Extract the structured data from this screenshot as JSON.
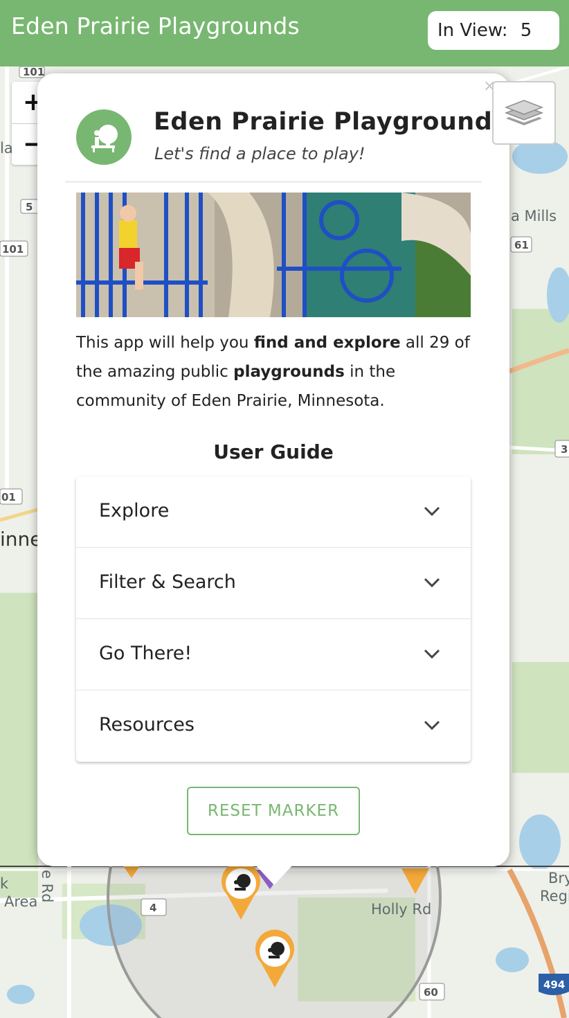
{
  "header": {
    "title": "Eden Prairie Playgrounds",
    "in_view_label": "In View:",
    "in_view_count": "5"
  },
  "map_controls": {
    "zoom_in": "+",
    "zoom_out": "−"
  },
  "popup": {
    "title": "Eden Prairie Playgrounds",
    "subtitle": "Let's find a place to play!",
    "description": {
      "p1": "This app will help you ",
      "b1": "find and explore",
      "p2": " all 29 of the amazing public ",
      "b2": "playgrounds",
      "p3": " in the community of Eden Prairie, Minnesota."
    },
    "guide_heading": "User Guide",
    "guide_items": [
      {
        "label": "Explore"
      },
      {
        "label": "Filter & Search"
      },
      {
        "label": "Go There!"
      },
      {
        "label": "Resources"
      }
    ],
    "reset_button": "RESET MARKER",
    "close_symbol": "×"
  },
  "map_labels": {
    "mills": "a Mills",
    "area_k": "k",
    "area": "Area",
    "rd": "e Rd",
    "holly": "Holly Rd",
    "bry": "Bry",
    "regi": "Regi",
    "inne": "inne",
    "la": "la"
  },
  "route_shields": [
    "101",
    "5",
    "101",
    "01",
    "61",
    "3",
    "4",
    "60",
    "494"
  ],
  "colors": {
    "brand_green": "#78b771",
    "marker_orange": "#f3a93a",
    "water": "#a7cfe8"
  }
}
